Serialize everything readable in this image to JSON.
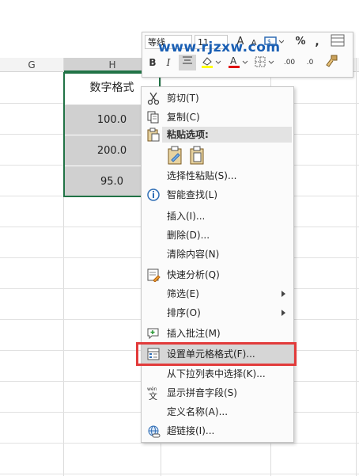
{
  "toolbar": {
    "font_name": "等线",
    "font_size": "11",
    "watermark": "www.rjzxw.com",
    "bold": "B",
    "italic": "I",
    "grow_font": "A",
    "shrink_font": "A",
    "percent": "%",
    "comma": ",",
    "font_color_letter": "A",
    "decimal_increase": ".00",
    "decimal_decrease": ".0",
    "highlight_color": "#ffff00",
    "font_color": "#e00000"
  },
  "columns": [
    {
      "label": "G"
    },
    {
      "label": "H"
    }
  ],
  "cells": [
    {
      "value": "数字格式"
    },
    {
      "value": "100.0"
    },
    {
      "value": "200.0"
    },
    {
      "value": "95.0"
    }
  ],
  "menu": {
    "cut": "剪切(T)",
    "copy": "复制(C)",
    "paste_options": "粘贴选项:",
    "paste_special": "选择性粘贴(S)...",
    "smart_lookup": "智能查找(L)",
    "insert": "插入(I)...",
    "delete": "删除(D)...",
    "clear_contents": "清除内容(N)",
    "quick_analysis": "快速分析(Q)",
    "filter": "筛选(E)",
    "sort": "排序(O)",
    "insert_comment": "插入批注(M)",
    "format_cells": "设置单元格格式(F)...",
    "pick_from_list": "从下拉列表中选择(K)...",
    "phonetic": "显示拼音字段(S)",
    "define_name": "定义名称(A)...",
    "hyperlink": "超链接(I)...",
    "phonetic_icon_text": "wén",
    "phonetic_icon_char": "文"
  },
  "colors": {
    "accent_green": "#217346",
    "highlight_red": "#e23b3b",
    "selected_cell_grey": "#d0d0d0"
  }
}
